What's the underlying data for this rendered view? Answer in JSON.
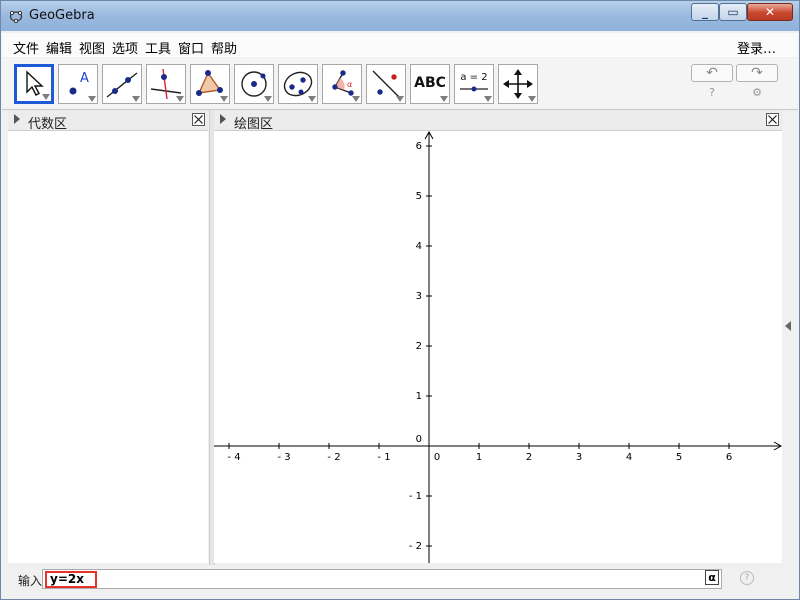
{
  "window": {
    "title": "GeoGebra"
  },
  "menu": [
    "文件",
    "编辑",
    "视图",
    "选项",
    "工具",
    "窗口",
    "帮助"
  ],
  "login": "登录…",
  "toolbar": {
    "tools": [
      {
        "name": "move-tool",
        "icon": "arrow-cursor-icon",
        "active": true
      },
      {
        "name": "point-tool",
        "icon": "point-icon",
        "text": "A"
      },
      {
        "name": "line-tool",
        "icon": "line-through-points-icon"
      },
      {
        "name": "perpendicular-tool",
        "icon": "perpendicular-line-icon"
      },
      {
        "name": "polygon-tool",
        "icon": "polygon-icon"
      },
      {
        "name": "circle-tool",
        "icon": "circle-center-point-icon"
      },
      {
        "name": "ellipse-tool",
        "icon": "ellipse-icon"
      },
      {
        "name": "angle-tool",
        "icon": "angle-icon",
        "text": "α"
      },
      {
        "name": "reflect-tool",
        "icon": "reflect-about-line-icon"
      },
      {
        "name": "text-tool",
        "icon": "text-icon",
        "text": "ABC"
      },
      {
        "name": "slider-tool",
        "icon": "slider-icon",
        "text": "a = 2"
      },
      {
        "name": "move-view-tool",
        "icon": "move-graphics-view-icon"
      }
    ],
    "undo_icon": "undo-icon",
    "redo_icon": "redo-icon"
  },
  "panels": {
    "algebra_title": "代数区",
    "graphics_title": "绘图区"
  },
  "graphics": {
    "x_ticks": [
      "- 4",
      "- 3",
      "- 2",
      "- 1",
      "0",
      "1",
      "2",
      "3",
      "4",
      "5",
      "6"
    ],
    "y_ticks_pos": [
      "1",
      "2",
      "3",
      "4",
      "5",
      "6"
    ],
    "y_ticks_neg": [
      "- 1",
      "- 2"
    ],
    "axis_color": "#000000"
  },
  "input": {
    "label": "输入",
    "value": "y=2x",
    "highlight_color": "#e8322b",
    "alpha_symbol": "α",
    "help_symbol": "?"
  }
}
